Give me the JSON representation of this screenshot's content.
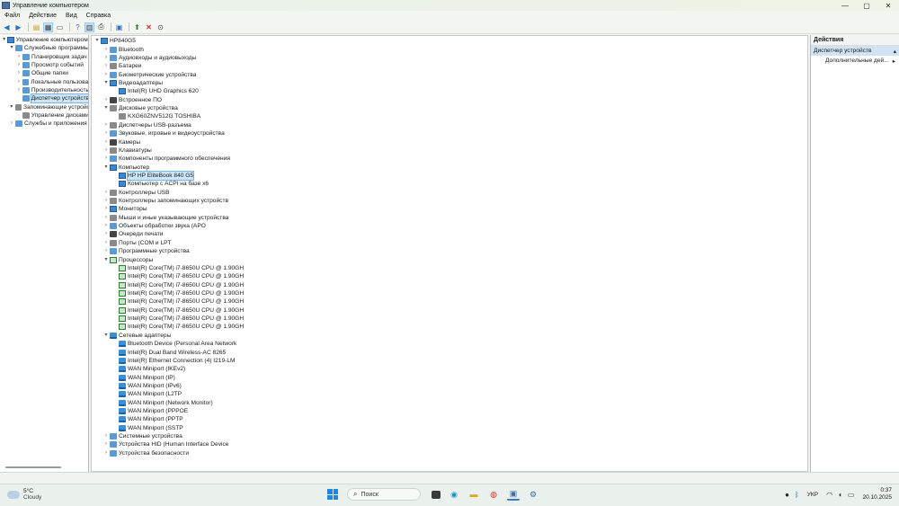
{
  "window": {
    "title": "Управление компьютером",
    "controls": {
      "minimize": "—",
      "maximize": "▢",
      "close": "✕"
    }
  },
  "menu": [
    "Файл",
    "Действие",
    "Вид",
    "Справка"
  ],
  "toolbar_icons": [
    "back-arrow-icon",
    "forward-arrow-icon",
    "folder-up-icon",
    "show-hide-tree-icon",
    "properties-icon",
    "help-icon",
    "view-icon",
    "print-icon",
    "monitor-icon",
    "update-driver-icon",
    "uninstall-icon",
    "disable-device-icon"
  ],
  "left_tree": [
    {
      "label": "Управление компьютером (л",
      "level": 0,
      "chev": "▾",
      "icon": "computer-management-icon"
    },
    {
      "label": "Служебные программы",
      "level": 1,
      "chev": "▾",
      "icon": "tools-icon"
    },
    {
      "label": "Планировщик задач",
      "level": 2,
      "chev": "›",
      "icon": "clock-icon"
    },
    {
      "label": "Просмотр событий",
      "level": 2,
      "chev": "›",
      "icon": "event-viewer-icon"
    },
    {
      "label": "Общие папки",
      "level": 2,
      "chev": "›",
      "icon": "shared-folder-icon"
    },
    {
      "label": "Локальные пользоват",
      "level": 2,
      "chev": "›",
      "icon": "users-icon"
    },
    {
      "label": "Производительность",
      "level": 2,
      "chev": "›",
      "icon": "performance-icon"
    },
    {
      "label": "Диспетчер устройств",
      "level": 2,
      "chev": "",
      "icon": "device-manager-icon",
      "selected": true
    },
    {
      "label": "Запоминающие устройст",
      "level": 1,
      "chev": "▾",
      "icon": "storage-icon"
    },
    {
      "label": "Управление дисками",
      "level": 2,
      "chev": "",
      "icon": "disk-icon"
    },
    {
      "label": "Службы и приложения",
      "level": 1,
      "chev": "›",
      "icon": "services-icon"
    }
  ],
  "device_tree": [
    {
      "label": "HP840G5",
      "level": 0,
      "chev": "▾",
      "icon": "computer-icon"
    },
    {
      "label": "Bluetooth",
      "level": 1,
      "chev": "›",
      "icon": "bluetooth-icon"
    },
    {
      "label": "Аудиовходы и аудиовыходы",
      "level": 1,
      "chev": "›",
      "icon": "audio-icon"
    },
    {
      "label": "Батареи",
      "level": 1,
      "chev": "›",
      "icon": "battery-icon"
    },
    {
      "label": "Биометрические устройства",
      "level": 1,
      "chev": "›",
      "icon": "biometric-icon"
    },
    {
      "label": "Видеоадаптеры",
      "level": 1,
      "chev": "▾",
      "icon": "display-adapter-icon"
    },
    {
      "label": "Intel(R) UHD Graphics 620",
      "level": 2,
      "chev": "",
      "icon": "display-adapter-icon"
    },
    {
      "label": "Встроенное ПО",
      "level": 1,
      "chev": "›",
      "icon": "firmware-icon"
    },
    {
      "label": "Дисковые устройства",
      "level": 1,
      "chev": "▾",
      "icon": "disk-drive-icon"
    },
    {
      "label": "KXG60ZNV512G TOSHIBA",
      "level": 2,
      "chev": "",
      "icon": "disk-drive-icon"
    },
    {
      "label": "Диспетчеры USB-разъема",
      "level": 1,
      "chev": "›",
      "icon": "usb-icon"
    },
    {
      "label": "Звуковые, игровые и видеоустройства",
      "level": 1,
      "chev": "›",
      "icon": "sound-icon"
    },
    {
      "label": "Камеры",
      "level": 1,
      "chev": "›",
      "icon": "camera-icon"
    },
    {
      "label": "Клавиатуры",
      "level": 1,
      "chev": "›",
      "icon": "keyboard-icon"
    },
    {
      "label": "Компоненты программного обеспечения",
      "level": 1,
      "chev": "›",
      "icon": "software-component-icon"
    },
    {
      "label": "Компьютер",
      "level": 1,
      "chev": "▾",
      "icon": "computer-icon"
    },
    {
      "label": "HP HP EliteBook 840 G5",
      "level": 2,
      "chev": "",
      "icon": "computer-icon",
      "selected": true
    },
    {
      "label": "Компьютер с ACPI на базе x6",
      "level": 2,
      "chev": "",
      "icon": "computer-icon"
    },
    {
      "label": "Контроллеры USB",
      "level": 1,
      "chev": "›",
      "icon": "usb-controller-icon"
    },
    {
      "label": "Контроллеры запоминающих устройств",
      "level": 1,
      "chev": "›",
      "icon": "storage-controller-icon"
    },
    {
      "label": "Мониторы",
      "level": 1,
      "chev": "›",
      "icon": "monitor-icon"
    },
    {
      "label": "Мыши и иные указывающие устройства",
      "level": 1,
      "chev": "›",
      "icon": "mouse-icon"
    },
    {
      "label": "Объекты обработки звука (APO",
      "level": 1,
      "chev": "›",
      "icon": "audio-processing-icon"
    },
    {
      "label": "Очереди печати",
      "level": 1,
      "chev": "›",
      "icon": "print-queue-icon"
    },
    {
      "label": "Порты (COM и LPT",
      "level": 1,
      "chev": "›",
      "icon": "port-icon"
    },
    {
      "label": "Программные устройства",
      "level": 1,
      "chev": "›",
      "icon": "software-device-icon"
    },
    {
      "label": "Процессоры",
      "level": 1,
      "chev": "▾",
      "icon": "processor-icon"
    },
    {
      "label": "Intel(R) Core(TM) i7-8650U CPU @ 1.90GH",
      "level": 2,
      "chev": "",
      "icon": "processor-icon"
    },
    {
      "label": "Intel(R) Core(TM) i7-8650U CPU @ 1.90GH",
      "level": 2,
      "chev": "",
      "icon": "processor-icon"
    },
    {
      "label": "Intel(R) Core(TM) i7-8650U CPU @ 1.90GH",
      "level": 2,
      "chev": "",
      "icon": "processor-icon"
    },
    {
      "label": "Intel(R) Core(TM) i7-8650U CPU @ 1.90GH",
      "level": 2,
      "chev": "",
      "icon": "processor-icon"
    },
    {
      "label": "Intel(R) Core(TM) i7-8650U CPU @ 1.90GH",
      "level": 2,
      "chev": "",
      "icon": "processor-icon"
    },
    {
      "label": "Intel(R) Core(TM) i7-8650U CPU @ 1.90GH",
      "level": 2,
      "chev": "",
      "icon": "processor-icon"
    },
    {
      "label": "Intel(R) Core(TM) i7-8650U CPU @ 1.90GH",
      "level": 2,
      "chev": "",
      "icon": "processor-icon"
    },
    {
      "label": "Intel(R) Core(TM) i7-8650U CPU @ 1.90GH",
      "level": 2,
      "chev": "",
      "icon": "processor-icon"
    },
    {
      "label": "Сетевые адаптеры",
      "level": 1,
      "chev": "▾",
      "icon": "network-adapter-icon"
    },
    {
      "label": "Bluetooth Device (Personal Area Network",
      "level": 2,
      "chev": "",
      "icon": "network-adapter-icon"
    },
    {
      "label": "Intel(R) Dual Band Wireless-AC 8265",
      "level": 2,
      "chev": "",
      "icon": "network-adapter-icon"
    },
    {
      "label": "Intel(R) Ethernet Connection (4) I219-LM",
      "level": 2,
      "chev": "",
      "icon": "network-adapter-icon"
    },
    {
      "label": "WAN Miniport (IKEv2)",
      "level": 2,
      "chev": "",
      "icon": "network-adapter-icon"
    },
    {
      "label": "WAN Miniport (IP)",
      "level": 2,
      "chev": "",
      "icon": "network-adapter-icon"
    },
    {
      "label": "WAN Miniport (IPv6)",
      "level": 2,
      "chev": "",
      "icon": "network-adapter-icon"
    },
    {
      "label": "WAN Miniport (L2TP",
      "level": 2,
      "chev": "",
      "icon": "network-adapter-icon"
    },
    {
      "label": "WAN Miniport (Network Monitor)",
      "level": 2,
      "chev": "",
      "icon": "network-adapter-icon"
    },
    {
      "label": "WAN Miniport (PPPOE",
      "level": 2,
      "chev": "",
      "icon": "network-adapter-icon"
    },
    {
      "label": "WAN Miniport (PPTP",
      "level": 2,
      "chev": "",
      "icon": "network-adapter-icon"
    },
    {
      "label": "WAN Miniport (SSTP",
      "level": 2,
      "chev": "",
      "icon": "network-adapter-icon"
    },
    {
      "label": "Системные устройства",
      "level": 1,
      "chev": "›",
      "icon": "system-device-icon"
    },
    {
      "label": "Устройства HID (Human Interface Device",
      "level": 1,
      "chev": "›",
      "icon": "hid-icon"
    },
    {
      "label": "Устройства безопасности",
      "level": 1,
      "chev": "›",
      "icon": "security-device-icon"
    }
  ],
  "actions": {
    "header": "Действия",
    "section": "Диспетчер устройств",
    "section_arrow": "▴",
    "more": "Дополнительные дей...",
    "more_arrow": "▸"
  },
  "taskbar": {
    "temp": "5°C",
    "weather": "Cloudy",
    "search_placeholder": "Поиск",
    "lang": "УКР",
    "time": "0:37",
    "date": "20.10.2025"
  }
}
